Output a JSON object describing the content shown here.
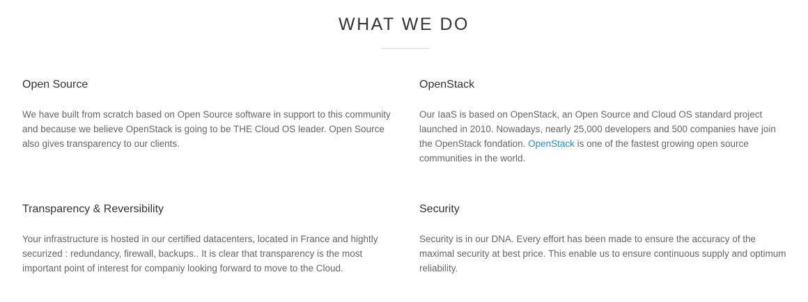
{
  "section": {
    "title": "WHAT WE DO"
  },
  "features": [
    {
      "title": "Open Source",
      "text": "We have built from scratch based on Open Source software in support to this community and because we believe OpenStack is going to be THE Cloud OS leader. Open Source also gives transparency to our clients."
    },
    {
      "title": "OpenStack",
      "text_before": "Our IaaS is based on OpenStack, an Open Source and Cloud OS standard project launched in 2010. Nowadays, nearly 25,000 developers and 500 companies have join the OpenStack fondation. ",
      "link": "OpenStack",
      "text_after": " is one of the fastest growing open source communities in the world."
    },
    {
      "title": "Transparency & Reversibility",
      "text": "Your infrastructure is hosted in our certified datacenters, located in France and hightly securized : redundancy, firewall, backups.. It is clear that transparency is the most important point of interest for companiy looking forward to move to the Cloud."
    },
    {
      "title": "Security",
      "text": "Security is in our DNA. Every effort has been made to ensure the accuracy of the maximal security at best price. This enable us to ensure continuous supply and optimum reliability."
    }
  ],
  "colors": {
    "heading": "#333333",
    "body_text": "#666666",
    "link": "#2a8ac4",
    "divider": "#d9d9d9"
  }
}
